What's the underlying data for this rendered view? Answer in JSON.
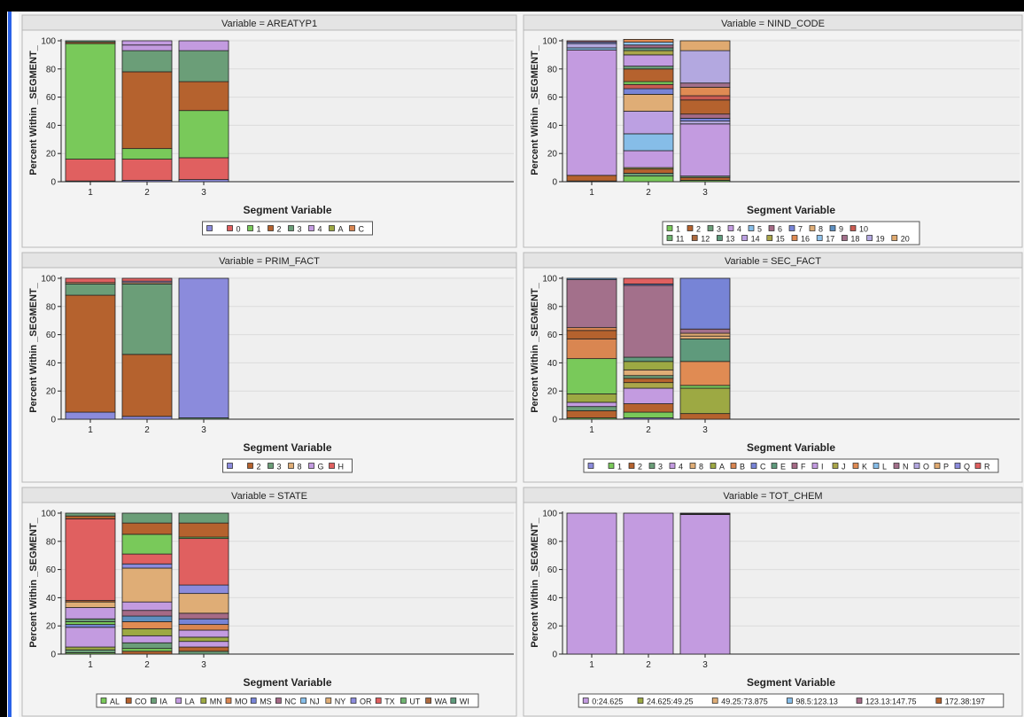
{
  "xlabel": "Segment Variable",
  "ylabel": "Percent Within _SEGMENT_",
  "colors": {
    "blank": "#8b8bdc",
    "0": "#e06060",
    "1": "#79c95a",
    "2": "#b5622e",
    "3": "#6b9e78",
    "4": "#c39be0",
    "A": "#9da943",
    "C": "#d98651",
    "5": "#86bde8",
    "6": "#a56a86",
    "7": "#7784d6",
    "8": "#dfad76",
    "9": "#5d8fc0",
    "10": "#ca5b52",
    "11": "#6fb370",
    "12": "#ad6a3f",
    "13": "#5f9a7c",
    "14": "#bca0e2",
    "15": "#aaa64a",
    "16": "#e08b53",
    "17": "#8fc1ea",
    "18": "#a3708b",
    "19": "#b3a8e0",
    "20": "#e0aa70"
  },
  "chart_data": [
    {
      "type": "bar",
      "stacked": true,
      "title": "Variable = AREATYP1",
      "categories": [
        "1",
        "2",
        "3"
      ],
      "ylim": [
        0,
        100
      ],
      "yticks": [
        "0",
        "20",
        "40",
        "60",
        "80",
        "100"
      ],
      "xlabel": "Segment Variable",
      "ylabel": "Percent Within _SEGMENT_",
      "legend": [
        "",
        "0",
        "1",
        "2",
        "3",
        "4",
        "A",
        "C"
      ],
      "legend_colors": [
        "#8b8bdc",
        "#e06060",
        "#79c95a",
        "#b5622e",
        "#6b9e78",
        "#c39be0",
        "#9da943",
        "#d98651"
      ],
      "stacks": [
        [
          {
            "v": 0.5,
            "c": "#8b8bdc"
          },
          {
            "v": 15.5,
            "c": "#e06060"
          },
          {
            "v": 82,
            "c": "#79c95a"
          },
          {
            "v": 1,
            "c": "#b5622e"
          },
          {
            "v": 1,
            "c": "#6b9e78"
          }
        ],
        [
          {
            "v": 1,
            "c": "#8b8bdc"
          },
          {
            "v": 15,
            "c": "#e06060"
          },
          {
            "v": 7.5,
            "c": "#79c95a"
          },
          {
            "v": 54.5,
            "c": "#b5622e"
          },
          {
            "v": 15,
            "c": "#6b9e78"
          },
          {
            "v": 4,
            "c": "#c39be0"
          },
          {
            "v": 3,
            "c": "#c39be0"
          }
        ],
        [
          {
            "v": 1.5,
            "c": "#8b8bdc"
          },
          {
            "v": 15.5,
            "c": "#e06060"
          },
          {
            "v": 33.5,
            "c": "#79c95a"
          },
          {
            "v": 20.5,
            "c": "#b5622e"
          },
          {
            "v": 22,
            "c": "#6b9e78"
          },
          {
            "v": 7,
            "c": "#c39be0"
          }
        ]
      ]
    },
    {
      "type": "bar",
      "stacked": true,
      "title": "Variable = NIND_CODE",
      "categories": [
        "1",
        "2",
        "3"
      ],
      "ylim": [
        0,
        100
      ],
      "yticks": [
        "0",
        "20",
        "40",
        "60",
        "80",
        "100"
      ],
      "xlabel": "Segment Variable",
      "ylabel": "Percent Within _SEGMENT_",
      "legend": [
        "1",
        "2",
        "3",
        "4",
        "5",
        "6",
        "7",
        "8",
        "9",
        "10",
        "11",
        "12",
        "13",
        "14",
        "15",
        "16",
        "17",
        "18",
        "19",
        "20"
      ],
      "legend_colors": [
        "#79c95a",
        "#b5622e",
        "#6b9e78",
        "#c39be0",
        "#86bde8",
        "#a56a86",
        "#7784d6",
        "#dfad76",
        "#5d8fc0",
        "#ca5b52",
        "#6fb370",
        "#ad6a3f",
        "#5f9a7c",
        "#bca0e2",
        "#aaa64a",
        "#e08b53",
        "#8fc1ea",
        "#a3708b",
        "#b3a8e0",
        "#e0aa70"
      ],
      "stacks": [
        [
          {
            "v": 0.5,
            "c": "#79c95a"
          },
          {
            "v": 4,
            "c": "#b5622e"
          },
          {
            "v": 89,
            "c": "#c39be0"
          },
          {
            "v": 1.5,
            "c": "#86bde8"
          },
          {
            "v": 3,
            "c": "#b3a8e0"
          },
          {
            "v": 1,
            "c": "#7784d6"
          },
          {
            "v": 1,
            "c": "#a56a86"
          }
        ],
        [
          {
            "v": 4,
            "c": "#79c95a"
          },
          {
            "v": 2,
            "c": "#6b9e78"
          },
          {
            "v": 3,
            "c": "#b5622e"
          },
          {
            "v": 1,
            "c": "#aaa64a"
          },
          {
            "v": 12,
            "c": "#c39be0"
          },
          {
            "v": 12,
            "c": "#86bde8"
          },
          {
            "v": 16,
            "c": "#bca0e2"
          },
          {
            "v": 12,
            "c": "#dfad76"
          },
          {
            "v": 4,
            "c": "#7784d6"
          },
          {
            "v": 3,
            "c": "#ca5b52"
          },
          {
            "v": 2,
            "c": "#79c95a"
          },
          {
            "v": 9,
            "c": "#b5622e"
          },
          {
            "v": 2,
            "c": "#6b9e78"
          },
          {
            "v": 8,
            "c": "#c39be0"
          },
          {
            "v": 3,
            "c": "#aaa64a"
          },
          {
            "v": 2,
            "c": "#5f9a7c"
          },
          {
            "v": 2,
            "c": "#a56a86"
          },
          {
            "v": 2,
            "c": "#8fc1ea"
          },
          {
            "v": 2,
            "c": "#e08b53"
          }
        ],
        [
          {
            "v": 1,
            "c": "#79c95a"
          },
          {
            "v": 2,
            "c": "#b5622e"
          },
          {
            "v": 1,
            "c": "#6b9e78"
          },
          {
            "v": 37,
            "c": "#c39be0"
          },
          {
            "v": 2,
            "c": "#b3a8e0"
          },
          {
            "v": 2,
            "c": "#7784d6"
          },
          {
            "v": 3,
            "c": "#a56a86"
          },
          {
            "v": 10,
            "c": "#b5622e"
          },
          {
            "v": 3,
            "c": "#ca5b52"
          },
          {
            "v": 6,
            "c": "#e08b53"
          },
          {
            "v": 3,
            "c": "#a3708b"
          },
          {
            "v": 23,
            "c": "#b3a8e0"
          },
          {
            "v": 7,
            "c": "#e0aa70"
          }
        ]
      ]
    },
    {
      "type": "bar",
      "stacked": true,
      "title": "Variable = PRIM_FACT",
      "categories": [
        "1",
        "2",
        "3"
      ],
      "ylim": [
        0,
        100
      ],
      "yticks": [
        "0",
        "20",
        "40",
        "60",
        "80",
        "100"
      ],
      "xlabel": "Segment Variable",
      "ylabel": "Percent Within _SEGMENT_",
      "legend": [
        "",
        "2",
        "3",
        "8",
        "G",
        "H"
      ],
      "legend_colors": [
        "#8b8bdc",
        "#b5622e",
        "#6b9e78",
        "#dfad76",
        "#c39be0",
        "#e06060"
      ],
      "stacks": [
        [
          {
            "v": 5,
            "c": "#8b8bdc"
          },
          {
            "v": 83,
            "c": "#b5622e"
          },
          {
            "v": 8,
            "c": "#6b9e78"
          },
          {
            "v": 1,
            "c": "#dfad76"
          },
          {
            "v": 3,
            "c": "#e06060"
          }
        ],
        [
          {
            "v": 2,
            "c": "#8b8bdc"
          },
          {
            "v": 44,
            "c": "#b5622e"
          },
          {
            "v": 50,
            "c": "#6b9e78"
          },
          {
            "v": 1,
            "c": "#dfad76"
          },
          {
            "v": 1,
            "c": "#c39be0"
          },
          {
            "v": 2,
            "c": "#e06060"
          }
        ],
        [
          {
            "v": 1,
            "c": "#6b9e78"
          },
          {
            "v": 99,
            "c": "#8b8bdc"
          }
        ]
      ]
    },
    {
      "type": "bar",
      "stacked": true,
      "title": "Variable = SEC_FACT",
      "categories": [
        "1",
        "2",
        "3"
      ],
      "ylim": [
        0,
        100
      ],
      "yticks": [
        "0",
        "20",
        "40",
        "60",
        "80",
        "100"
      ],
      "xlabel": "Segment Variable",
      "ylabel": "Percent Within _SEGMENT_",
      "legend": [
        "",
        "1",
        "2",
        "3",
        "4",
        "8",
        "A",
        "B",
        "C",
        "E",
        "F",
        "I",
        "J",
        "K",
        "L",
        "N",
        "O",
        "P",
        "Q",
        "R"
      ],
      "legend_colors": [
        "#8b8bdc",
        "#79c95a",
        "#b5622e",
        "#6b9e78",
        "#c39be0",
        "#dfad76",
        "#9da943",
        "#d98651",
        "#7784d6",
        "#5f9a7c",
        "#a56a86",
        "#c39be0",
        "#aaa64a",
        "#e08b53",
        "#86bde8",
        "#a3708b",
        "#b3a8e0",
        "#e0aa70",
        "#8b8bdc",
        "#e06060"
      ],
      "stacks": [
        [
          {
            "v": 1,
            "c": "#79c95a"
          },
          {
            "v": 5,
            "c": "#b5622e"
          },
          {
            "v": 3,
            "c": "#6b9e78"
          },
          {
            "v": 3,
            "c": "#c39be0"
          },
          {
            "v": 6,
            "c": "#9da943"
          },
          {
            "v": 25,
            "c": "#79c95a"
          },
          {
            "v": 14,
            "c": "#d98651"
          },
          {
            "v": 6,
            "c": "#b5622e"
          },
          {
            "v": 2,
            "c": "#e08b53"
          },
          {
            "v": 34,
            "c": "#a3708b"
          },
          {
            "v": 1,
            "c": "#5d8fc0"
          }
        ],
        [
          {
            "v": 1,
            "c": "#8b8bdc"
          },
          {
            "v": 4,
            "c": "#79c95a"
          },
          {
            "v": 6,
            "c": "#b5622e"
          },
          {
            "v": 11,
            "c": "#c39be0"
          },
          {
            "v": 4,
            "c": "#aaa64a"
          },
          {
            "v": 3,
            "c": "#b5622e"
          },
          {
            "v": 2,
            "c": "#6b9e78"
          },
          {
            "v": 4,
            "c": "#dfad76"
          },
          {
            "v": 6,
            "c": "#9da943"
          },
          {
            "v": 3,
            "c": "#5f9a7c"
          },
          {
            "v": 51,
            "c": "#a3708b"
          },
          {
            "v": 1,
            "c": "#7784d6"
          },
          {
            "v": 4,
            "c": "#e06060"
          }
        ],
        [
          {
            "v": 4,
            "c": "#b5622e"
          },
          {
            "v": 18,
            "c": "#9da943"
          },
          {
            "v": 2,
            "c": "#79c95a"
          },
          {
            "v": 17,
            "c": "#e08b53"
          },
          {
            "v": 16,
            "c": "#5f9a7c"
          },
          {
            "v": 2,
            "c": "#dfad76"
          },
          {
            "v": 2,
            "c": "#e0aa70"
          },
          {
            "v": 3,
            "c": "#a3708b"
          },
          {
            "v": 36,
            "c": "#7784d6"
          }
        ]
      ]
    },
    {
      "type": "bar",
      "stacked": true,
      "title": "Variable = STATE",
      "categories": [
        "1",
        "2",
        "3"
      ],
      "ylim": [
        0,
        100
      ],
      "yticks": [
        "0",
        "20",
        "40",
        "60",
        "80",
        "100"
      ],
      "xlabel": "Segment Variable",
      "ylabel": "Percent Within _SEGMENT_",
      "legend": [
        "AL",
        "CO",
        "IA",
        "LA",
        "MN",
        "MO",
        "MS",
        "NC",
        "NJ",
        "NY",
        "OR",
        "TX",
        "UT",
        "WA",
        "WI"
      ],
      "legend_colors": [
        "#79c95a",
        "#b5622e",
        "#6b9e78",
        "#c39be0",
        "#9da943",
        "#d98651",
        "#7784d6",
        "#a56a86",
        "#86bde8",
        "#dfad76",
        "#8b8bdc",
        "#e06060",
        "#6fb370",
        "#ad6a3f",
        "#5f9a7c"
      ],
      "stacks": [
        [
          {
            "v": 1,
            "c": "#79c95a"
          },
          {
            "v": 2,
            "c": "#6b9e78"
          },
          {
            "v": 2,
            "c": "#9da943"
          },
          {
            "v": 14,
            "c": "#c39be0"
          },
          {
            "v": 2,
            "c": "#7784d6"
          },
          {
            "v": 2,
            "c": "#79c95a"
          },
          {
            "v": 2,
            "c": "#6b9e78"
          },
          {
            "v": 8,
            "c": "#c39be0"
          },
          {
            "v": 4,
            "c": "#dfad76"
          },
          {
            "v": 1,
            "c": "#b5622e"
          },
          {
            "v": 58,
            "c": "#e06060"
          },
          {
            "v": 2,
            "c": "#b5622e"
          },
          {
            "v": 2,
            "c": "#6b9e78"
          }
        ],
        [
          {
            "v": 2,
            "c": "#b5622e"
          },
          {
            "v": 2,
            "c": "#79c95a"
          },
          {
            "v": 4,
            "c": "#6b9e78"
          },
          {
            "v": 5,
            "c": "#c39be0"
          },
          {
            "v": 5,
            "c": "#9da943"
          },
          {
            "v": 5,
            "c": "#e08b53"
          },
          {
            "v": 4,
            "c": "#5d8fc0"
          },
          {
            "v": 4,
            "c": "#a56a86"
          },
          {
            "v": 6,
            "c": "#c39be0"
          },
          {
            "v": 24,
            "c": "#dfad76"
          },
          {
            "v": 3,
            "c": "#8b8bdc"
          },
          {
            "v": 7,
            "c": "#e06060"
          },
          {
            "v": 14,
            "c": "#79c95a"
          },
          {
            "v": 8,
            "c": "#b5622e"
          },
          {
            "v": 7,
            "c": "#6b9e78"
          }
        ],
        [
          {
            "v": 2,
            "c": "#6b9e78"
          },
          {
            "v": 3,
            "c": "#b5622e"
          },
          {
            "v": 4,
            "c": "#c39be0"
          },
          {
            "v": 3,
            "c": "#9da943"
          },
          {
            "v": 5,
            "c": "#c39be0"
          },
          {
            "v": 4,
            "c": "#d98651"
          },
          {
            "v": 4,
            "c": "#7784d6"
          },
          {
            "v": 4,
            "c": "#a56a86"
          },
          {
            "v": 14,
            "c": "#dfad76"
          },
          {
            "v": 6,
            "c": "#8b8bdc"
          },
          {
            "v": 33,
            "c": "#e06060"
          },
          {
            "v": 1,
            "c": "#79c95a"
          },
          {
            "v": 10,
            "c": "#b5622e"
          },
          {
            "v": 7,
            "c": "#6b9e78"
          }
        ]
      ]
    },
    {
      "type": "bar",
      "stacked": true,
      "title": "Variable = TOT_CHEM",
      "categories": [
        "1",
        "2",
        "3"
      ],
      "ylim": [
        0,
        100
      ],
      "yticks": [
        "0",
        "20",
        "40",
        "60",
        "80",
        "100"
      ],
      "xlabel": "Segment Variable",
      "ylabel": "Percent Within _SEGMENT_",
      "legend": [
        "0:24.625",
        "24.625:49.25",
        "49.25:73.875",
        "98.5:123.13",
        "123.13:147.75",
        "172.38:197"
      ],
      "legend_colors": [
        "#c39be0",
        "#9da943",
        "#dfad76",
        "#86bde8",
        "#a56a86",
        "#b5622e"
      ],
      "stacks": [
        [
          {
            "v": 100,
            "c": "#c39be0"
          }
        ],
        [
          {
            "v": 100,
            "c": "#c39be0"
          }
        ],
        [
          {
            "v": 99,
            "c": "#c39be0"
          },
          {
            "v": 0.5,
            "c": "#9da943"
          },
          {
            "v": 0.5,
            "c": "#b5622e"
          }
        ]
      ]
    }
  ]
}
